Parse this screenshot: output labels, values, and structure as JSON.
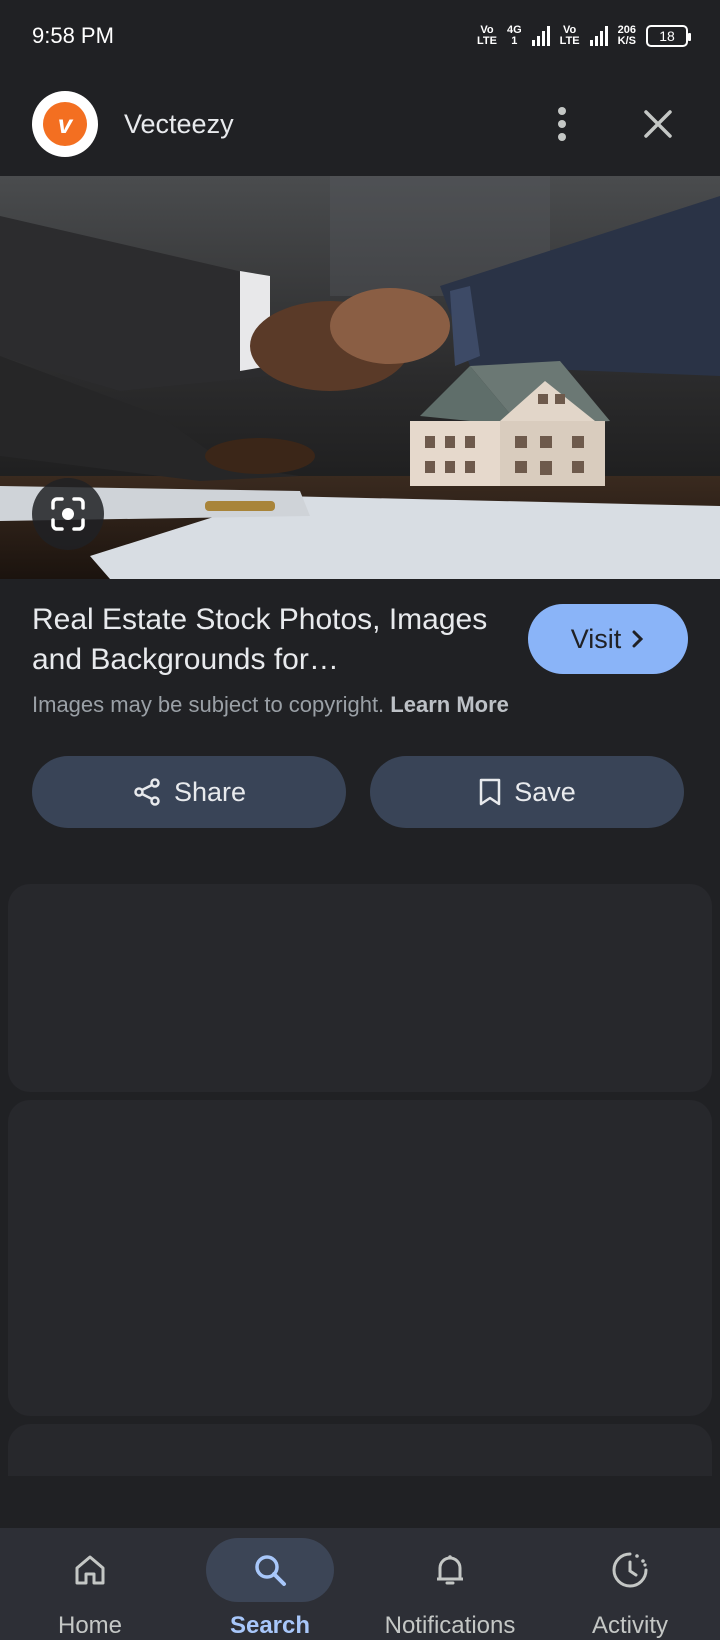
{
  "status_bar": {
    "time": "9:58 PM",
    "volte1_top": "Vo",
    "volte1_bottom": "LTE",
    "net_top": "4G",
    "net_bottom": "1",
    "volte2_top": "Vo",
    "volte2_bottom": "LTE",
    "speed_top": "206",
    "speed_bottom": "K/S",
    "battery": "18"
  },
  "header": {
    "site_name": "Vecteezy",
    "logo_letter": "v"
  },
  "result": {
    "title": "Real Estate Stock Photos, Images and Backgrounds for…",
    "copyright_text": "Images may be subject to copyright.",
    "learn_more": "Learn More",
    "visit_label": "Visit"
  },
  "actions": {
    "share_label": "Share",
    "save_label": "Save"
  },
  "bottom_nav": {
    "items": [
      {
        "label": "Home",
        "icon": "home-icon"
      },
      {
        "label": "Search",
        "icon": "search-icon",
        "active": true
      },
      {
        "label": "Notifications",
        "icon": "bell-icon"
      },
      {
        "label": "Activity",
        "icon": "activity-icon"
      }
    ]
  },
  "colors": {
    "background": "#202124",
    "accent": "#8ab4f8",
    "brand_orange": "#f36f21",
    "button_bg": "#394457"
  }
}
